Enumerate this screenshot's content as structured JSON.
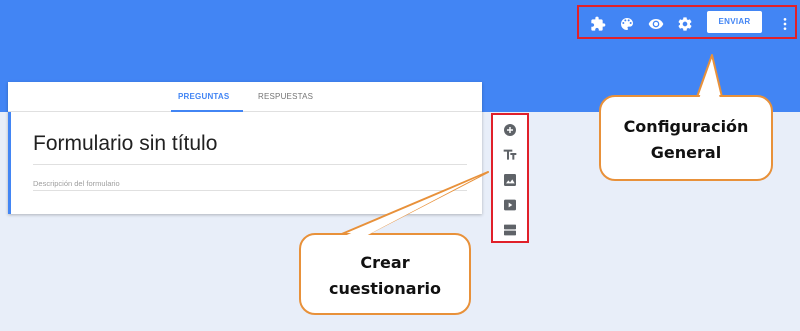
{
  "header": {
    "send_label": "ENVIAR",
    "icons": [
      "puzzle-icon",
      "palette-icon",
      "eye-icon",
      "gear-icon",
      "more-vert-icon"
    ],
    "colors": {
      "brand": "#4285f4",
      "highlight": "#e0202a",
      "callout_border": "#e8913a"
    }
  },
  "tabs": [
    {
      "label": "PREGUNTAS",
      "active": true
    },
    {
      "label": "RESPUESTAS",
      "active": false
    }
  ],
  "form": {
    "title": "Formulario sin título",
    "description_placeholder": "Descripción del formulario"
  },
  "side_toolbar": {
    "icons": [
      "add-circle-icon",
      "text-format-icon",
      "image-icon",
      "video-icon",
      "section-icon"
    ]
  },
  "callouts": {
    "general": [
      "Configuración",
      "General"
    ],
    "create": [
      "Crear",
      "cuestionario"
    ]
  }
}
